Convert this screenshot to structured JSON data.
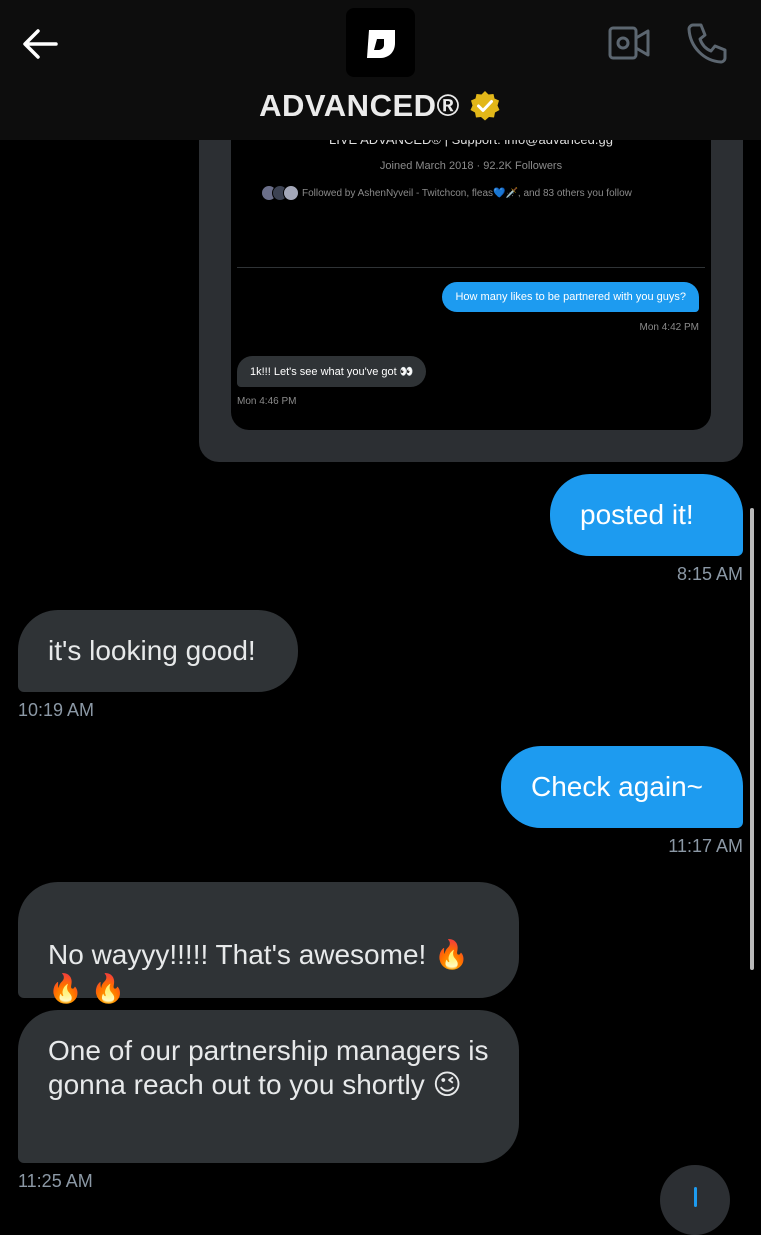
{
  "header": {
    "title": "ADVANCED®",
    "verified": true,
    "icons": [
      "back-arrow-icon",
      "video-camera-icon",
      "phone-icon",
      "verified-badge-icon"
    ]
  },
  "shared_screenshot": {
    "bio_partial": "LIVE ADVANCED® | Support: info@advanced.gg",
    "joined": "Joined March 2018 · 92.2K Followers",
    "followed_by": "Followed by AshenNyveil - Twitchcon, fleas💙🗡️, and 83 others you follow",
    "messages": [
      {
        "text": "How many likes to be partnered with you guys?",
        "time": "Mon 4:42 PM",
        "direction": "outgoing"
      },
      {
        "text": "1k!!! Let's see what you've got 👀",
        "time": "Mon 4:46 PM",
        "direction": "incoming"
      }
    ]
  },
  "messages": [
    {
      "text": "posted it!",
      "time": "8:15 AM",
      "direction": "outgoing"
    },
    {
      "text": "it's looking good!",
      "time": "10:19 AM",
      "direction": "incoming"
    },
    {
      "text": "Check again~",
      "time": "11:17 AM",
      "direction": "outgoing"
    },
    {
      "text": "No wayyy!!!!! That's awesome! 🔥\n🔥 🔥",
      "direction": "incoming"
    },
    {
      "text": "One of our partnership managers is gonna reach out to you shortly 😉",
      "time": "11:25 AM",
      "direction": "incoming"
    }
  ],
  "colors": {
    "background": "#000000",
    "outgoing_bubble": "#1d9bf0",
    "incoming_bubble": "#2f3336",
    "verified_badge": "#e2b719"
  }
}
